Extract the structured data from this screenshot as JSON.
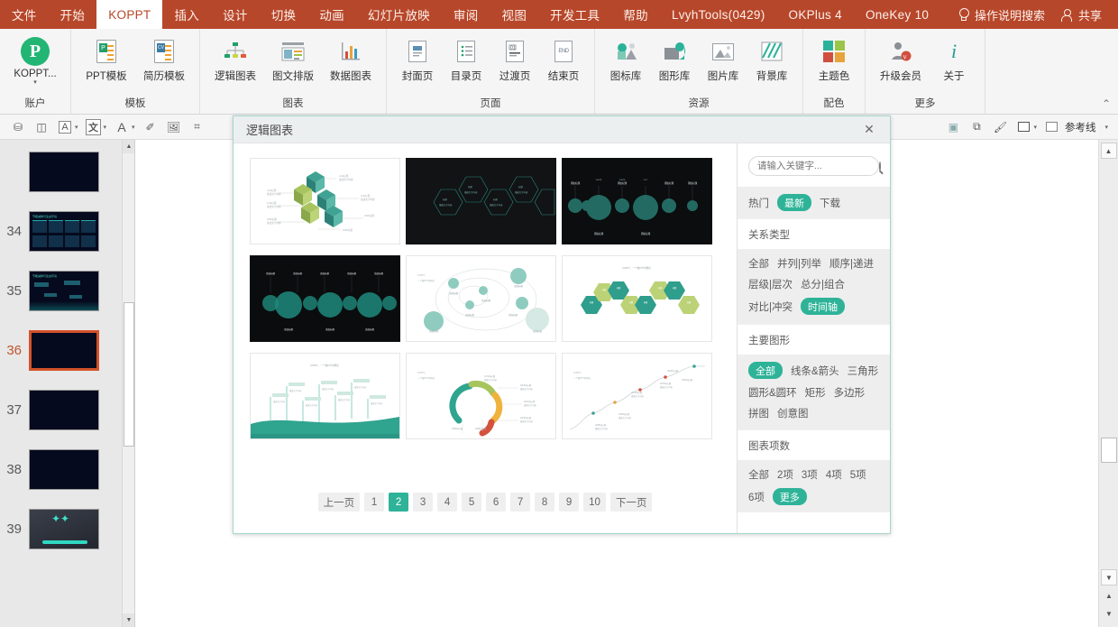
{
  "menubar": {
    "items": [
      {
        "label": "文件",
        "active": false
      },
      {
        "label": "开始",
        "active": false
      },
      {
        "label": "KOPPT",
        "active": true
      },
      {
        "label": "插入",
        "active": false
      },
      {
        "label": "设计",
        "active": false
      },
      {
        "label": "切换",
        "active": false
      },
      {
        "label": "动画",
        "active": false
      },
      {
        "label": "幻灯片放映",
        "active": false
      },
      {
        "label": "审阅",
        "active": false
      },
      {
        "label": "视图",
        "active": false
      },
      {
        "label": "开发工具",
        "active": false
      },
      {
        "label": "帮助",
        "active": false
      },
      {
        "label": "LvyhTools(0429)",
        "active": false
      },
      {
        "label": "OKPlus 4",
        "active": false
      },
      {
        "label": "OneKey 10",
        "active": false
      }
    ],
    "tell_me": "操作说明搜索",
    "tell_me_icon": "lightbulb-icon",
    "share": "共享",
    "share_icon": "person-add-icon",
    "bg_color": "#b7472a"
  },
  "ribbon": {
    "collapse_icon": "chevron-up-icon",
    "groups": [
      {
        "label": "账户",
        "items": [
          {
            "label": "KOPPT...",
            "icon": "koppt-logo-icon",
            "has_caret": true
          }
        ]
      },
      {
        "label": "模板",
        "items": [
          {
            "label": "PPT模板",
            "icon": "ppt-template-icon"
          },
          {
            "label": "简历模板",
            "icon": "resume-template-icon"
          }
        ]
      },
      {
        "label": "图表",
        "items": [
          {
            "label": "逻辑图表",
            "icon": "org-chart-icon"
          },
          {
            "label": "图文排版",
            "icon": "image-text-layout-icon"
          },
          {
            "label": "数据图表",
            "icon": "bar-chart-icon"
          }
        ]
      },
      {
        "label": "页面",
        "items": [
          {
            "label": "封面页",
            "icon": "cover-page-icon"
          },
          {
            "label": "目录页",
            "icon": "toc-page-icon"
          },
          {
            "label": "过渡页",
            "icon": "transition-page-icon"
          },
          {
            "label": "结束页",
            "icon": "end-page-icon"
          }
        ]
      },
      {
        "label": "资源",
        "items": [
          {
            "label": "图标库",
            "icon": "icon-library-icon"
          },
          {
            "label": "图形库",
            "icon": "shape-library-icon"
          },
          {
            "label": "图片库",
            "icon": "image-library-icon"
          },
          {
            "label": "背景库",
            "icon": "background-library-icon"
          }
        ]
      },
      {
        "label": "配色",
        "items": [
          {
            "label": "主题色",
            "icon": "theme-color-icon"
          }
        ]
      },
      {
        "label": "更多",
        "items": [
          {
            "label": "升级会员",
            "icon": "upgrade-member-icon"
          },
          {
            "label": "关于",
            "icon": "info-icon"
          }
        ]
      }
    ]
  },
  "toolbar2": {
    "guides_label": "参考线",
    "icons": [
      "stamp-icon",
      "align-icon",
      "text-box-icon",
      "text-char-icon",
      "font-color-icon",
      "eyedropper-icon",
      "image-replace-icon",
      "shape-merge-icon"
    ],
    "right_icons": [
      "select-icon",
      "arrange-icon",
      "format-painter-icon",
      "fill-color-icon",
      "guide-color-icon"
    ]
  },
  "slides": {
    "items": [
      {
        "number": "",
        "selected": false,
        "style": "blank"
      },
      {
        "number": "34",
        "selected": false,
        "style": "content"
      },
      {
        "number": "35",
        "selected": false,
        "style": "content2"
      },
      {
        "number": "36",
        "selected": true,
        "style": "blank"
      },
      {
        "number": "37",
        "selected": false,
        "style": "blank"
      },
      {
        "number": "38",
        "selected": false,
        "style": "blank"
      },
      {
        "number": "39",
        "selected": false,
        "style": "photo"
      }
    ],
    "scroll_up_icon": "chevron-up-icon",
    "scroll_down_icon": "chevron-down-icon"
  },
  "modal": {
    "title": "逻辑图表",
    "close_icon": "close-icon",
    "gallery": {
      "thumbnails": [
        {
          "id": 1,
          "style": "cubes-light",
          "heading": "KOPPT、",
          "subheading": "一个做PPT的网址"
        },
        {
          "id": 2,
          "style": "hexagons-dark",
          "heading": "KOPPT、一个做PPT的网址"
        },
        {
          "id": 3,
          "style": "timeline-dark",
          "heading": "KOPPT、一个做PPT的网址"
        },
        {
          "id": 4,
          "style": "circles-dark",
          "heading": "KOPPT、一个做PPT的网址"
        },
        {
          "id": 5,
          "style": "orbit-light",
          "heading": "KOPPT、",
          "subheading": "一个做PPT的网址"
        },
        {
          "id": 6,
          "style": "hexrow-light",
          "heading": "KOPPT、一个做PPT的网址"
        },
        {
          "id": 7,
          "style": "wave-light",
          "heading": "KOPPT、一个做PPT的网址"
        },
        {
          "id": 8,
          "style": "arcs-light",
          "heading": "KOPPT、",
          "subheading": "一个做PPT的网址"
        },
        {
          "id": 9,
          "style": "zigzag-light",
          "heading": "KOPPT、",
          "subheading": "一个做PPT的网址"
        }
      ]
    },
    "pagination": {
      "prev_label": "上一页",
      "next_label": "下一页",
      "pages": [
        "1",
        "2",
        "3",
        "4",
        "5",
        "6",
        "7",
        "8",
        "9",
        "10"
      ],
      "active_page": "2"
    },
    "filters": {
      "search_placeholder": "请输入关键字...",
      "search_value": "",
      "search_icon": "search-icon",
      "sort_tabs": [
        {
          "label": "热门",
          "active": false
        },
        {
          "label": "最新",
          "active": true
        },
        {
          "label": "下载",
          "active": false
        }
      ],
      "sections": [
        {
          "title": "关系类型",
          "options": [
            {
              "label": "全部",
              "active": false
            },
            {
              "label": "并列|列举",
              "active": false
            },
            {
              "label": "顺序|递进",
              "active": false
            },
            {
              "label": "层级|层次",
              "active": false
            },
            {
              "label": "总分|组合",
              "active": false
            },
            {
              "label": "对比|冲突",
              "active": false
            },
            {
              "label": "时间轴",
              "active": true
            }
          ]
        },
        {
          "title": "主要图形",
          "options": [
            {
              "label": "全部",
              "active": true
            },
            {
              "label": "线条&箭头",
              "active": false
            },
            {
              "label": "三角形",
              "active": false
            },
            {
              "label": "圆形&圆环",
              "active": false
            },
            {
              "label": "矩形",
              "active": false
            },
            {
              "label": "多边形",
              "active": false
            },
            {
              "label": "拼图",
              "active": false
            },
            {
              "label": "创意图",
              "active": false
            }
          ]
        },
        {
          "title": "图表项数",
          "options": [
            {
              "label": "全部",
              "active": false
            },
            {
              "label": "2项",
              "active": false
            },
            {
              "label": "3项",
              "active": false
            },
            {
              "label": "4项",
              "active": false
            },
            {
              "label": "5项",
              "active": false
            },
            {
              "label": "6项",
              "active": false
            },
            {
              "label": "更多",
              "active": true
            }
          ]
        }
      ]
    }
  },
  "colors": {
    "menubar": "#b7472a",
    "accent_teal": "#2eb398",
    "selection_orange": "#d4522a",
    "ribbon_bg": "#f5f5f5"
  }
}
